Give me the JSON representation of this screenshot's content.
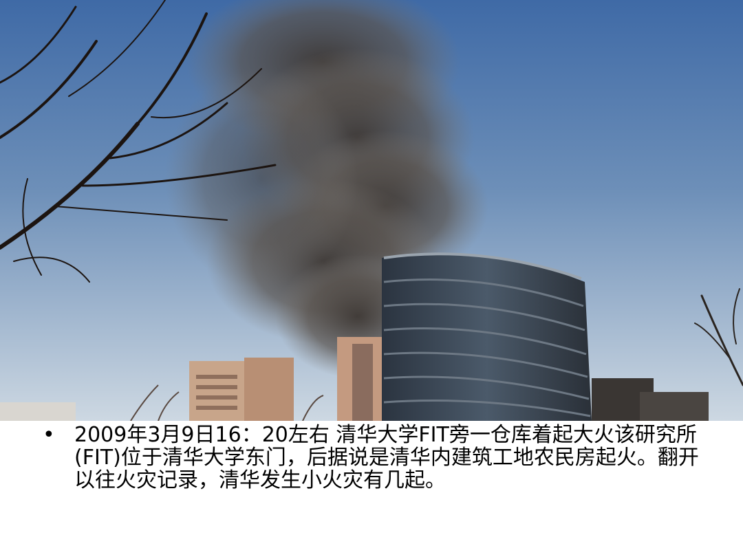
{
  "slide": {
    "bullet_symbol": "•",
    "bullet_text": "2009年3月9日16：20左右 清华大学FIT旁一仓库着起大火该研究所(FIT)位于清华大学东门，后据说是清华内建筑工地农民房起火。翻开以往火灾记录，清华发生小火灾有几起。"
  },
  "colors": {
    "sky_top": "#3f6aa6",
    "sky_bottom": "#c9d6e3",
    "smoke": "#4a4440",
    "building": "#2f3a45",
    "tree": "#1c1410"
  }
}
